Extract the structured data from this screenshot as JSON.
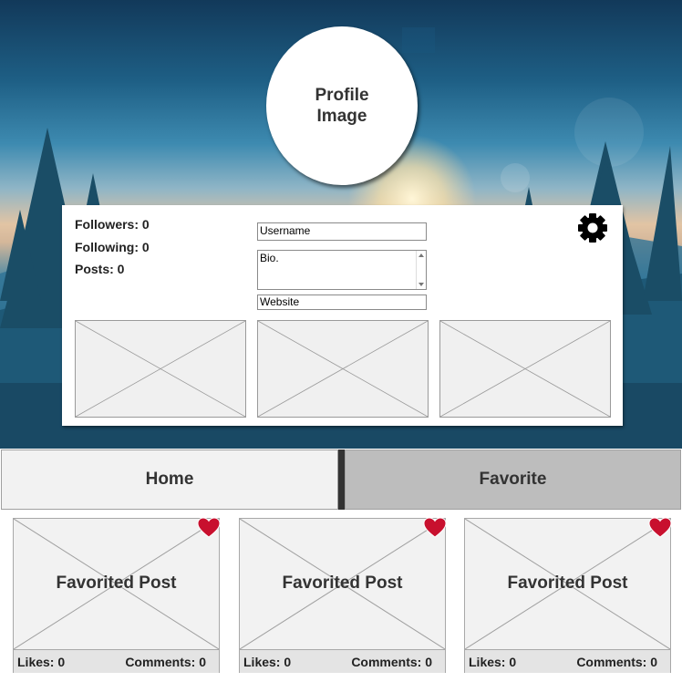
{
  "profile": {
    "image_label": "Profile Image",
    "followers": "Followers: 0",
    "following": "Following: 0",
    "posts": "Posts: 0",
    "username_value": "Username",
    "bio_value": "Bio.",
    "website_value": "Website",
    "settings_icon": "gear-icon"
  },
  "tabs": [
    {
      "label": "Home"
    },
    {
      "label": "Favorite"
    }
  ],
  "favorites": [
    {
      "title": "Favorited Post",
      "likes": "Likes: 0",
      "comments": "Comments: 0",
      "icon": "heart-icon"
    },
    {
      "title": "Favorited Post",
      "likes": "Likes: 0",
      "comments": "Comments: 0",
      "icon": "heart-icon"
    },
    {
      "title": "Favorited Post",
      "likes": "Likes: 0",
      "comments": "Comments: 0",
      "icon": "heart-icon"
    }
  ],
  "colors": {
    "heart": "#c8102e",
    "active_tab": "#f2f2f2",
    "inactive_tab": "#bdbdbd"
  }
}
